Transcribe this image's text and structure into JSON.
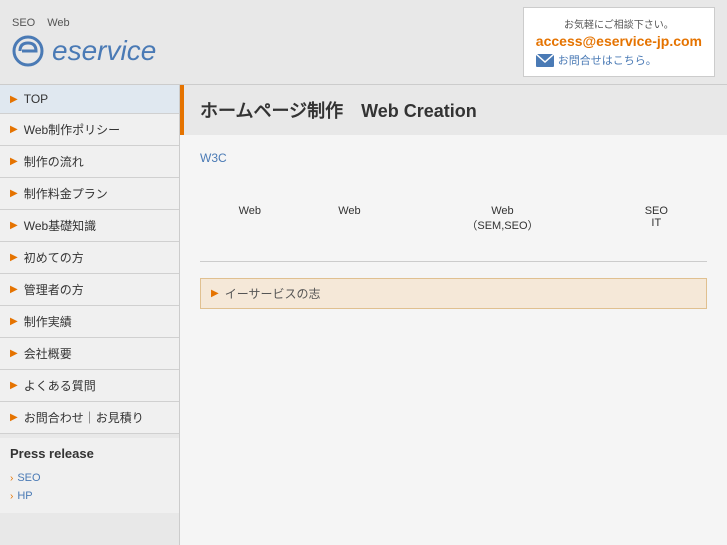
{
  "header": {
    "nav_items": [
      "SEO",
      "Web"
    ],
    "logo_text": "eservice",
    "contact_label": "お気軽にご相談下さい。",
    "contact_email": "access@eservice-jp.com",
    "contact_link": "お問合せはこちら。"
  },
  "sidebar": {
    "items": [
      {
        "label": "TOP"
      },
      {
        "label": "Web制作ポリシー"
      },
      {
        "label": "制作の流れ"
      },
      {
        "label": "制作料金プラン"
      },
      {
        "label": "Web基礎知識"
      },
      {
        "label": "初めての方"
      },
      {
        "label": "管理者の方"
      },
      {
        "label": "制作実績"
      },
      {
        "label": "会社概要"
      },
      {
        "label": "よくある質問"
      },
      {
        "label": "お問合わせ｜お見積り"
      }
    ],
    "press_release": {
      "title": "Press release",
      "items": [
        {
          "label": "SEO"
        },
        {
          "label": "HP"
        }
      ]
    }
  },
  "content": {
    "page_title": "ホームページ制作　Web Creation",
    "w3c_link": "W3C",
    "table": {
      "rows": [
        [
          "Web",
          "Web",
          "Web\n（SEM,SEO）",
          "SEO\nIT"
        ]
      ]
    },
    "bottom_section_label": "イーサービスの志"
  }
}
